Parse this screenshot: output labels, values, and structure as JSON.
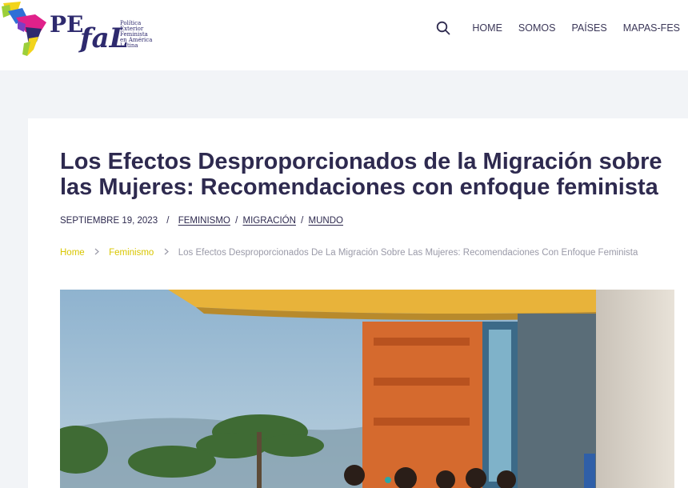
{
  "brand": {
    "logo_pe": "PE",
    "logo_fal": "faL",
    "logo_subtitle": [
      "Política",
      "Exterior",
      "Feminista",
      "en América",
      "Latina"
    ],
    "colors": {
      "navy": "#2e2a6e",
      "yellow": "#f2d41c",
      "magenta": "#e0218a",
      "blue": "#2f6fd6",
      "lime": "#9ccf3a"
    }
  },
  "nav": {
    "search_icon": "search-icon",
    "items": [
      "HOME",
      "SOMOS",
      "PAÍSES",
      "MAPAS-FES"
    ]
  },
  "article": {
    "title": "Los Efectos Desproporcionados de la Migración sobre las Mujeres: Recomendaciones con enfoque feminista",
    "date": "SEPTIEMBRE 19, 2023",
    "meta_separator": "/",
    "categories": [
      "FEMINISMO",
      "MIGRACIÓN",
      "MUNDO"
    ],
    "category_separator": "/"
  },
  "breadcrumb": {
    "items": [
      "Home",
      "Feminismo",
      "Los Efectos Desproporcionados De La Migración Sobre Las Mujeres: Recomendaciones Con Enfoque Feminista"
    ],
    "link_color": "#d9c600",
    "chevron_icon": "chevron-right-icon"
  },
  "hero_image": {
    "description_icon": "photo"
  }
}
